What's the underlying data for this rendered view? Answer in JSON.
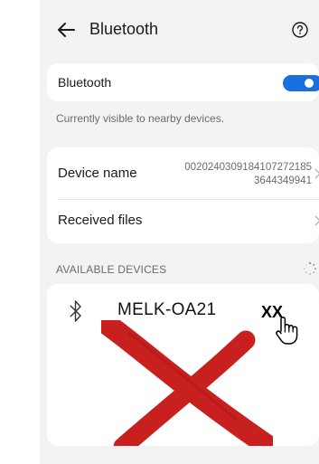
{
  "header": {
    "title": "Bluetooth"
  },
  "bluetooth": {
    "label": "Bluetooth",
    "enabled": true,
    "visibility_note": "Currently visible to nearby devices."
  },
  "device": {
    "name_label": "Device name",
    "name_value": "0020240309184107272185 3644349941",
    "received_label": "Received files"
  },
  "available": {
    "section_title": "AVAILABLE DEVICES",
    "device_name": "MELK-OA21",
    "annotation": "XX"
  },
  "colors": {
    "accent": "#1a6fe0",
    "cross": "#c8201f",
    "background": "#f1f3f5"
  },
  "icons": [
    "back-arrow-icon",
    "help-icon",
    "chevron-right-icon",
    "loading-spinner-icon",
    "bluetooth-icon",
    "hand-pointer-icon",
    "red-x-mark"
  ]
}
